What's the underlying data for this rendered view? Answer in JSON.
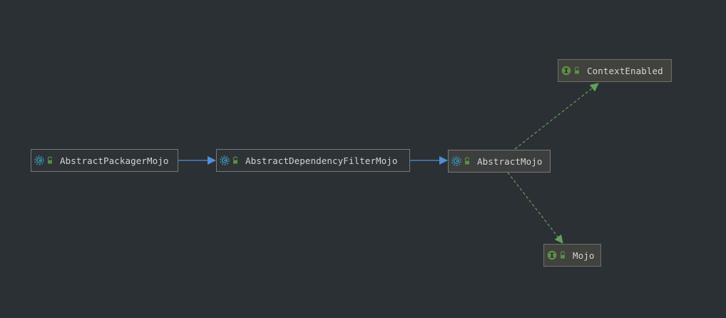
{
  "diagram": {
    "nodes": [
      {
        "id": "packager",
        "label": "AbstractPackagerMojo",
        "kind": "abstract-class",
        "icon": "abstract-class-icon"
      },
      {
        "id": "filter",
        "label": "AbstractDependencyFilterMojo",
        "kind": "abstract-class",
        "icon": "abstract-class-icon"
      },
      {
        "id": "abstract",
        "label": "AbstractMojo",
        "kind": "abstract-class",
        "icon": "abstract-class-icon"
      },
      {
        "id": "context",
        "label": "ContextEnabled",
        "kind": "interface",
        "icon": "interface-icon"
      },
      {
        "id": "mojo",
        "label": "Mojo",
        "kind": "interface",
        "icon": "interface-icon"
      }
    ],
    "edges": [
      {
        "from": "packager",
        "to": "filter",
        "relation": "extends"
      },
      {
        "from": "filter",
        "to": "abstract",
        "relation": "extends"
      },
      {
        "from": "abstract",
        "to": "context",
        "relation": "implements"
      },
      {
        "from": "abstract",
        "to": "mojo",
        "relation": "implements"
      }
    ],
    "colors": {
      "background": "#2b3034",
      "extends_edge": "#4f8fd6",
      "implements_edge": "#62a05a",
      "class_icon": "#3e86a0",
      "interface_icon": "#5a8f47",
      "lock_icon": "#5a8f47"
    }
  }
}
